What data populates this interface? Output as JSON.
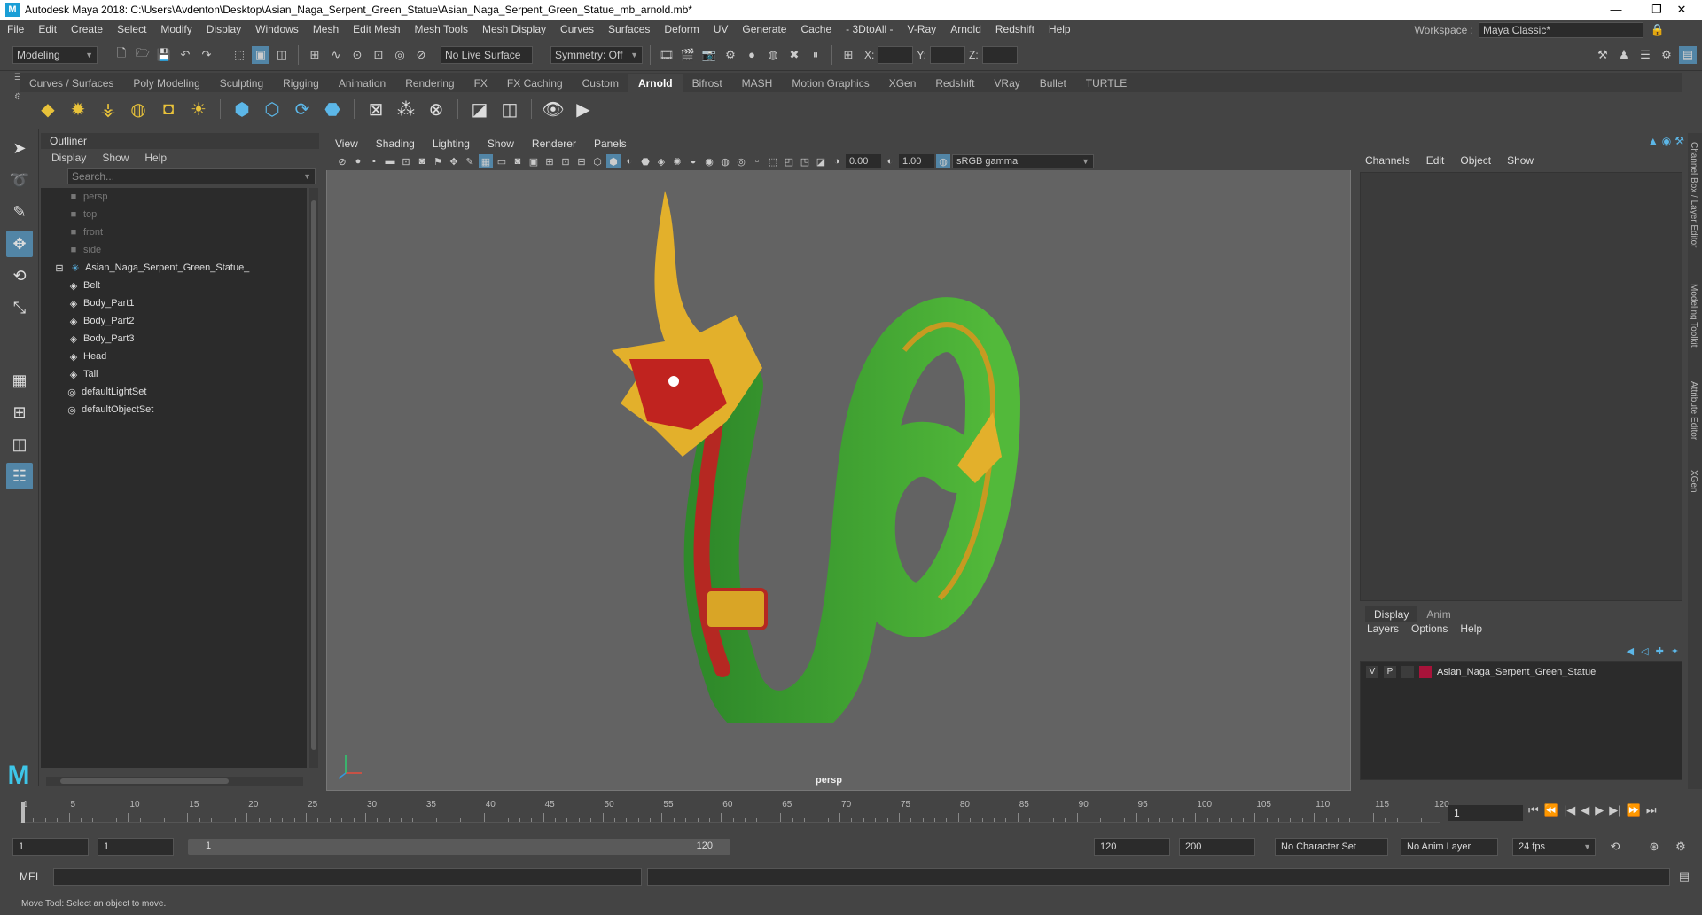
{
  "window": {
    "title": "Autodesk Maya 2018: C:\\Users\\Avdenton\\Desktop\\Asian_Naga_Serpent_Green_Statue\\Asian_Naga_Serpent_Green_Statue_mb_arnold.mb*",
    "minimize": "—",
    "maximize": "❐",
    "close": "✕"
  },
  "menubar": {
    "items": [
      "File",
      "Edit",
      "Create",
      "Select",
      "Modify",
      "Display",
      "Windows",
      "Mesh",
      "Edit Mesh",
      "Mesh Tools",
      "Mesh Display",
      "Curves",
      "Surfaces",
      "Deform",
      "UV",
      "Generate",
      "Cache",
      "- 3DtoAll -",
      "V-Ray",
      "Arnold",
      "Redshift",
      "Help"
    ],
    "workspace_label": "Workspace :",
    "workspace_value": "Maya Classic*"
  },
  "statusline": {
    "mode": "Modeling",
    "live_surface": "No Live Surface",
    "symmetry": "Symmetry: Off",
    "x_label": "X:",
    "y_label": "Y:",
    "z_label": "Z:"
  },
  "shelf": {
    "tabs": [
      "Curves / Surfaces",
      "Poly Modeling",
      "Sculpting",
      "Rigging",
      "Animation",
      "Rendering",
      "FX",
      "FX Caching",
      "Custom",
      "Arnold",
      "Bifrost",
      "MASH",
      "Motion Graphics",
      "XGen",
      "Redshift",
      "VRay",
      "Bullet",
      "TURTLE"
    ],
    "active": "Arnold"
  },
  "outliner": {
    "title": "Outliner",
    "menu": [
      "Display",
      "Show",
      "Help"
    ],
    "search_placeholder": "Search...",
    "items": [
      {
        "label": "persp",
        "dim": true,
        "depth": 0,
        "icon": "camera-icon"
      },
      {
        "label": "top",
        "dim": true,
        "depth": 0,
        "icon": "camera-icon"
      },
      {
        "label": "front",
        "dim": true,
        "depth": 0,
        "icon": "camera-icon"
      },
      {
        "label": "side",
        "dim": true,
        "depth": 0,
        "icon": "camera-icon"
      },
      {
        "label": "Asian_Naga_Serpent_Green_Statue_",
        "dim": false,
        "depth": 0,
        "icon": "group-icon"
      },
      {
        "label": "Belt",
        "dim": false,
        "depth": 1,
        "icon": "mesh-icon"
      },
      {
        "label": "Body_Part1",
        "dim": false,
        "depth": 1,
        "icon": "mesh-icon"
      },
      {
        "label": "Body_Part2",
        "dim": false,
        "depth": 1,
        "icon": "mesh-icon"
      },
      {
        "label": "Body_Part3",
        "dim": false,
        "depth": 1,
        "icon": "mesh-icon"
      },
      {
        "label": "Head",
        "dim": false,
        "depth": 1,
        "icon": "mesh-icon"
      },
      {
        "label": "Tail",
        "dim": false,
        "depth": 1,
        "icon": "mesh-icon"
      },
      {
        "label": "defaultLightSet",
        "dim": false,
        "depth": 0,
        "icon": "set-icon"
      },
      {
        "label": "defaultObjectSet",
        "dim": false,
        "depth": 0,
        "icon": "set-icon"
      }
    ]
  },
  "viewport": {
    "menu": [
      "View",
      "Shading",
      "Lighting",
      "Show",
      "Renderer",
      "Panels"
    ],
    "exposure": "0.00",
    "gamma": "1.00",
    "color_space": "sRGB gamma",
    "camera": "persp"
  },
  "channelbox": {
    "menu": [
      "Channels",
      "Edit",
      "Object",
      "Show"
    ],
    "layer_tabs": [
      "Display",
      "Anim"
    ],
    "layer_menu": [
      "Layers",
      "Options",
      "Help"
    ],
    "layer": {
      "v": "V",
      "p": "P",
      "name": "Asian_Naga_Serpent_Green_Statue",
      "color": "#a8133a"
    }
  },
  "sidetabs": [
    "Channel Box / Layer Editor",
    "Modeling Toolkit",
    "Attribute Editor",
    "XGen"
  ],
  "timeline": {
    "ticks": [
      "1",
      "5",
      "10",
      "15",
      "20",
      "25",
      "30",
      "35",
      "40",
      "45",
      "50",
      "55",
      "60",
      "65",
      "70",
      "75",
      "80",
      "85",
      "90",
      "95",
      "100",
      "105",
      "110",
      "115",
      "120"
    ],
    "current_frame": "1"
  },
  "range": {
    "start": "1",
    "playback_start": "1",
    "range_start": "1",
    "range_end": "120",
    "playback_end": "120",
    "end": "200",
    "character_set": "No Character Set",
    "anim_layer": "No Anim Layer",
    "fps": "24 fps"
  },
  "command": {
    "label": "MEL"
  },
  "status": {
    "help": "Move Tool: Select an object to move."
  }
}
